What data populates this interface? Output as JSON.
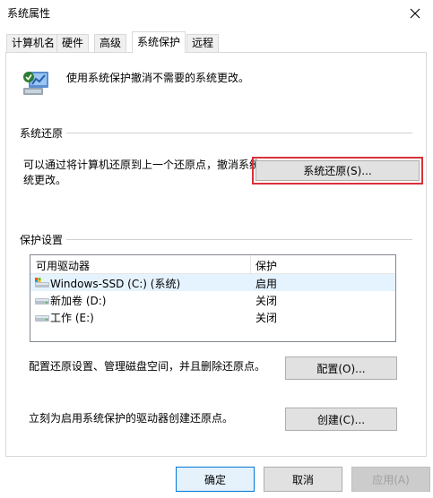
{
  "window": {
    "title": "系统属性"
  },
  "tabs": [
    {
      "label": "计算机名"
    },
    {
      "label": "硬件"
    },
    {
      "label": "高级"
    },
    {
      "label": "系统保护",
      "active": true
    },
    {
      "label": "远程"
    }
  ],
  "header": {
    "description": "使用系统保护撤消不需要的系统更改。"
  },
  "system_restore": {
    "group_label": "系统还原",
    "text_line1": "可以通过将计算机还原到上一个还原点，撤消系统",
    "text_line2": "统更改。",
    "button_label": "系统还原(S)..."
  },
  "protection": {
    "group_label": "保护设置",
    "columns": [
      "可用驱动器",
      "保护"
    ],
    "drives": [
      {
        "name": "Windows-SSD (C:) (系统)",
        "state": "启用",
        "icon": "system-drive-icon"
      },
      {
        "name": "新加卷 (D:)",
        "state": "关闭",
        "icon": "drive-icon"
      },
      {
        "name": "工作 (E:)",
        "state": "关闭",
        "icon": "drive-icon"
      }
    ],
    "configure_text": "配置还原设置、管理磁盘空间，并且删除还原点。",
    "configure_button": "配置(O)...",
    "create_text": "立刻为启用系统保护的驱动器创建还原点。",
    "create_button": "创建(C)..."
  },
  "footer": {
    "ok": "确定",
    "cancel": "取消",
    "apply": "应用(A)"
  },
  "colors": {
    "highlight_border": "#d9313a",
    "default_button_border": "#0078d7",
    "selected_row": "#e5f3ff"
  }
}
